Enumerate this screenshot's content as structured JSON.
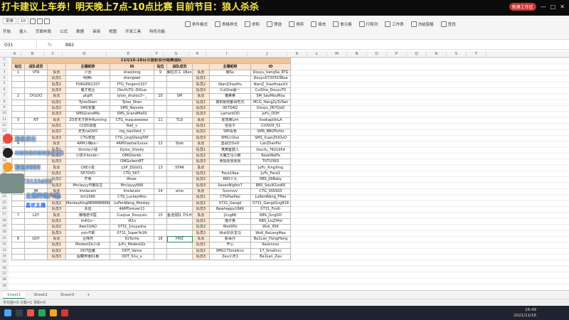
{
  "banner": {
    "text": "打卡建议上车券！明天晚上7点-10点比赛 目前节目：狼人杀杀",
    "pill": "新建工作区",
    "min": "—",
    "max": "□",
    "close": "✕"
  },
  "ribbon": {
    "groups": [
      "开始",
      "插入",
      "页面布局",
      "公式",
      "数据",
      "审阅",
      "视图",
      "开发工具",
      "特色功能"
    ],
    "font": "宋体",
    "font_size": "10",
    "tools": [
      "条件格式",
      "表格样式",
      "求和",
      "筛选",
      "排序",
      "填充",
      "单元格",
      "行和列",
      "工作表",
      "冻结窗格",
      "查找"
    ]
  },
  "formula_bar": {
    "namebox": "O31",
    "fx": "fx",
    "value": "BB2"
  },
  "columns": [
    "A",
    "B",
    "C",
    "D",
    "E",
    "F",
    "G",
    "H",
    "I",
    "J",
    "K",
    "L",
    "M",
    "N",
    "O",
    "P",
    "Q",
    "R",
    "S",
    "T"
  ],
  "rows": [
    "1",
    "2",
    "3",
    "4",
    "5",
    "6",
    "7",
    "8",
    "9",
    "10",
    "11",
    "12",
    "13",
    "14",
    "15",
    "16",
    "17",
    "18",
    "19",
    "20",
    "21",
    "22",
    "23",
    "24",
    "25",
    "26",
    "27",
    "28",
    "29",
    "30",
    "31",
    "32",
    "33",
    "34",
    "35",
    "36",
    "37",
    "38",
    "39"
  ],
  "table": {
    "title": "11月16-18日斗鱼职业分组赛战队",
    "headers": [
      "站位",
      "战队成员",
      "",
      "主播昵称",
      "ID",
      "站位",
      "战队成员",
      "",
      "主播昵称",
      "ID"
    ],
    "rows": [
      [
        "1",
        "VTA",
        "队长",
        "少回",
        "shaojiong",
        "9",
        "鲸拉打工【Bang】",
        "队长",
        "鲸Sa",
        "Douyu_bangSa_RTG"
      ],
      [
        "",
        "",
        "队员1",
        "明神c",
        "zhengwei",
        "",
        "",
        "队员1",
        "",
        "Douyu57205S3Rua"
      ],
      [
        "",
        "",
        "队员2",
        "FORGEN1337",
        "FTG_Forgen1337",
        "",
        "",
        "队员2",
        "NianZXiaoHu",
        "NianZ_XiaoHuaxXX"
      ],
      [
        "",
        "",
        "队员3",
        "鬼才他压",
        "DouYuTV--DiGua",
        "",
        "",
        "队员3",
        "CuiOne最一",
        "CuiOne_DouyuTV"
      ],
      [
        "2",
        "DYLOO",
        "队长",
        "ptglft",
        "tyloo_zhutou3~_",
        "10",
        "SM",
        "队长",
        "猫莱莱",
        "SM_SaoMouMou"
      ],
      [
        "",
        "",
        "队员1",
        "TylooShen",
        "Tyloo_Shen",
        "",
        "",
        "队员1",
        "叙的射的都出吃元",
        "MCG_Hang2yTuTaei"
      ],
      [
        "",
        "",
        "队员2",
        "SMS安塞",
        "SMS_Naivete",
        "",
        "",
        "队员2",
        "067QAQ",
        "Douyu_067QaQ"
      ],
      [
        "",
        "",
        "队员3",
        "SMSGrandMa",
        "SMS_GrandMaSS",
        "",
        "",
        "队员3",
        "LamontDD",
        "JuFu_DDH"
      ],
      [
        "3",
        "NT",
        "队长",
        "2D岁天才新手Running",
        "CTG_maqueeeeee",
        "11",
        "TLD",
        "队长",
        "陈亮西Lnh",
        "itookapillnLA"
      ],
      [
        "",
        "",
        "队员1",
        "CDZK道金",
        "Ba0_v",
        "",
        "",
        "队员1",
        "信信子",
        "110929_S1"
      ],
      [
        "",
        "",
        "队员2",
        "天天naOVO",
        "ctg_tiantlent_t",
        "",
        "",
        "队员2",
        "SMI青色",
        "SMS_BBQFishtz"
      ],
      [
        "",
        "",
        "队员3",
        "CTG安陆",
        "CTG_LingQiengTAT",
        "",
        "",
        "队员3",
        "SMS小Ovo",
        "SMS_XuanZhiOvO"
      ],
      [
        "4",
        "",
        "队长",
        "4AM小嗨xx~",
        "4AMXiaohai1xxxx",
        "12",
        "Stah",
        "队长",
        "蓝战华OvO",
        "LanZhanFei"
      ],
      [
        "",
        "",
        "队员1",
        "Shmily小钱",
        "Dyloo_Shmily",
        "",
        "",
        "队员1",
        "寓寓客鼓人",
        "DouYu_7601954"
      ],
      [
        "",
        "",
        "队员2",
        "小饼子lionkk~",
        "OMGlionkk",
        "",
        "",
        "队员2",
        "大魔王马小鹏",
        "RoseWaiFa"
      ],
      [
        "",
        "",
        "队员3",
        "",
        "OMGolientBT",
        "",
        "",
        "队员3",
        "我情愿愿愿愿",
        "TUTU36D"
      ],
      [
        "5",
        "",
        "队长",
        "CRE小肚",
        "LSP_ZGGO1",
        "13",
        "STAR",
        "队长",
        "",
        "JuFu_XingXing"
      ],
      [
        "",
        "",
        "队员1",
        "567OVO",
        "CTG_567-",
        "",
        "",
        "队员1",
        "Face1Aaa",
        "JuFu_Face1"
      ],
      [
        "",
        "",
        "队员2",
        "芒果",
        "iRose-",
        "",
        "",
        "队员2",
        "RBS十九",
        "RBS_Jl9Baby"
      ],
      [
        "",
        "",
        "队员3",
        "Mrclayyy可霸先生",
        "Mrclayyy666",
        "",
        "",
        "队员3",
        "SevenNights7",
        "RBS_SouiK1osKK"
      ],
      [
        "6",
        "IM",
        "队长",
        "Imslacein",
        "Imslacein",
        "14",
        "emo",
        "队长",
        "Svvvvvv",
        "CTG_SSSSSS"
      ],
      [
        "",
        "",
        "队员1",
        "km1999",
        "CTG_LuckeyWss",
        "",
        "",
        "队员1",
        "CTGPaoPao",
        "LufienWang_PPao"
      ],
      [
        "",
        "",
        "队员2",
        "MonkeyKingNB88888888",
        "LuFenWang_Monkey",
        "",
        "",
        "队员2",
        "0731_Gangd",
        "0731_Gangd1ng818"
      ],
      [
        "",
        "",
        "队员3",
        "永远",
        "4AMForever11",
        "",
        "",
        "队员3",
        "Newhappy16KK",
        "0731_FovK-"
      ],
      [
        "7",
        "LZY",
        "队长",
        "懒喵老中医",
        "Cuojiue_Douyutv",
        "15",
        "鱼泡混队【YLHZ】",
        "队长",
        "J1ng88",
        "RBS_J1ngDD"
      ],
      [
        "",
        "",
        "队员1",
        "imR1s~",
        "iR1s",
        "",
        "",
        "队员1",
        "撸子英",
        "RBS_LiuZiHei"
      ],
      [
        "",
        "",
        "队员2",
        "Awe1QAQ",
        "0731_1nuyasha",
        "",
        "",
        "队员2",
        "Wuk95k",
        "Wuk_95K"
      ],
      [
        "",
        "",
        "队员3",
        "ysin不卸",
        "0731_SuperYe1N",
        "",
        "",
        "队员3",
        "Wuk扒扒龙马",
        "WuK_BaLongMax"
      ],
      [
        "8",
        "GDY",
        "队长",
        "豆味然",
        "91Turtle",
        "16",
        "HHZ",
        "队长",
        "颜毒仔",
        "Ba1Lan_HongHong"
      ],
      [
        "",
        "",
        "队员1",
        "ModestZe小泽",
        "JuFu_ModestZe",
        "",
        "",
        "队员1",
        "开心",
        "Kaixinxxx"
      ],
      [
        "",
        "",
        "队员2",
        "DDT血魔",
        "DDT_Vama",
        "",
        "",
        "队员2",
        "SMG17Smallccc",
        "17_Smallccc"
      ],
      [
        "",
        "",
        "队员3",
        "留藏养殖61番",
        "DDT_61u_u",
        "",
        "",
        "队员3",
        "Zau小天1",
        "Ba1Lan_Zau"
      ]
    ]
  },
  "overlay": {
    "items": [
      "鲸鱼优仕",
      "HONGHONG##X",
      "鲸鱼8888",
      "1073123455"
    ],
    "talk": "主播的客户端",
    "sticker": "喜欢主播"
  },
  "sheets": [
    "Sheet1",
    "Sheet2",
    "Sheet3",
    "+"
  ],
  "status": "平均值=0  计数=1  求和=0",
  "clock": {
    "time": "16:49",
    "date": "2021/11/16"
  },
  "colors": {
    "banner_bg": "#0b0b0b",
    "banner_text": "#f7e64a",
    "title_bg": "#f0c39a",
    "header_bg": "#fbe3cf",
    "accent": "#2d8a5e"
  }
}
